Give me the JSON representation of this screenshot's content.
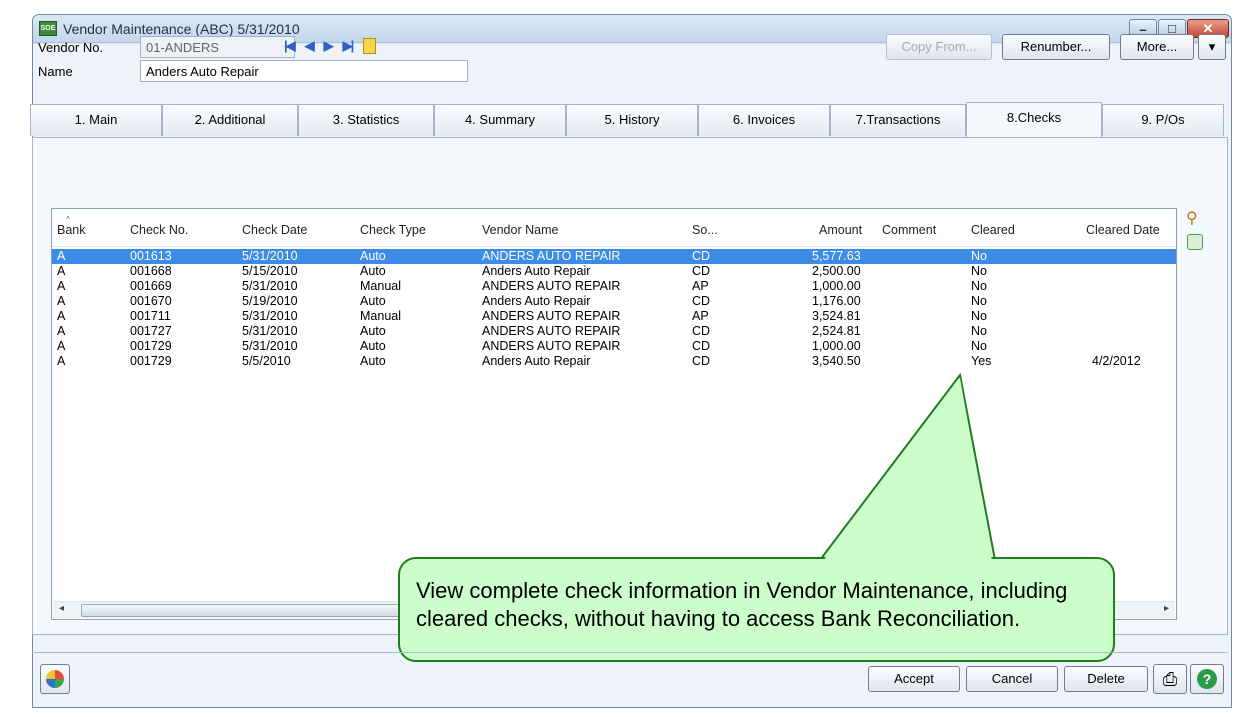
{
  "window": {
    "title": "Vendor Maintenance (ABC) 5/31/2010",
    "app_icon_text": "SOE"
  },
  "header": {
    "vendor_no_label": "Vendor No.",
    "vendor_no_value": "01-ANDERS",
    "name_label": "Name",
    "name_value": "Anders Auto Repair",
    "copy_from_label": "Copy From...",
    "renumber_label": "Renumber...",
    "more_label": "More..."
  },
  "tabs": [
    {
      "label": "1. Main"
    },
    {
      "label": "2. Additional"
    },
    {
      "label": "3. Statistics"
    },
    {
      "label": "4. Summary"
    },
    {
      "label": "5. History"
    },
    {
      "label": "6. Invoices"
    },
    {
      "label": "7.Transactions"
    },
    {
      "label": "8.Checks"
    },
    {
      "label": "9. P/Os"
    }
  ],
  "grid": {
    "columns": [
      "Bank",
      "Check No.",
      "Check Date",
      "Check Type",
      "Vendor Name",
      "So...",
      "Amount",
      "Comment",
      "Cleared",
      "Cleared Date"
    ],
    "rows": [
      {
        "bank": "A",
        "check_no": "001613",
        "date": "5/31/2010",
        "type": "Auto",
        "vendor": "ANDERS AUTO REPAIR",
        "source": "CD",
        "amount": "5,577.63",
        "comment": "",
        "cleared": "No",
        "cleared_date": ""
      },
      {
        "bank": "A",
        "check_no": "001668",
        "date": "5/15/2010",
        "type": "Auto",
        "vendor": "Anders Auto Repair",
        "source": "CD",
        "amount": "2,500.00",
        "comment": "",
        "cleared": "No",
        "cleared_date": ""
      },
      {
        "bank": "A",
        "check_no": "001669",
        "date": "5/31/2010",
        "type": "Manual",
        "vendor": "ANDERS AUTO REPAIR",
        "source": "AP",
        "amount": "1,000.00",
        "comment": "",
        "cleared": "No",
        "cleared_date": ""
      },
      {
        "bank": "A",
        "check_no": "001670",
        "date": "5/19/2010",
        "type": "Auto",
        "vendor": "Anders Auto Repair",
        "source": "CD",
        "amount": "1,176.00",
        "comment": "",
        "cleared": "No",
        "cleared_date": ""
      },
      {
        "bank": "A",
        "check_no": "001711",
        "date": "5/31/2010",
        "type": "Manual",
        "vendor": "ANDERS AUTO REPAIR",
        "source": "AP",
        "amount": "3,524.81",
        "comment": "",
        "cleared": "No",
        "cleared_date": ""
      },
      {
        "bank": "A",
        "check_no": "001727",
        "date": "5/31/2010",
        "type": "Auto",
        "vendor": "ANDERS AUTO REPAIR",
        "source": "CD",
        "amount": "2,524.81",
        "comment": "",
        "cleared": "No",
        "cleared_date": ""
      },
      {
        "bank": "A",
        "check_no": "001729",
        "date": "5/31/2010",
        "type": "Auto",
        "vendor": "ANDERS AUTO REPAIR",
        "source": "CD",
        "amount": "1,000.00",
        "comment": "",
        "cleared": "No",
        "cleared_date": ""
      },
      {
        "bank": "A",
        "check_no": "001729",
        "date": "5/5/2010",
        "type": "Auto",
        "vendor": "Anders Auto Repair",
        "source": "CD",
        "amount": "3,540.50",
        "comment": "",
        "cleared": "Yes",
        "cleared_date": "4/2/2012"
      }
    ]
  },
  "callout": {
    "text": "View complete check information in Vendor Maintenance, including cleared checks, without having to access Bank Reconciliation."
  },
  "footer": {
    "accept_label": "Accept",
    "cancel_label": "Cancel",
    "delete_label": "Delete"
  },
  "colors": {
    "selection": "#3c8be4",
    "callout_fill": "#ccfecc",
    "callout_border": "#1f7d1f"
  },
  "icons": [
    "first-record-icon",
    "previous-record-icon",
    "next-record-icon",
    "last-record-icon",
    "memo-icon",
    "binoculars-icon",
    "print-icon",
    "help-icon"
  ]
}
